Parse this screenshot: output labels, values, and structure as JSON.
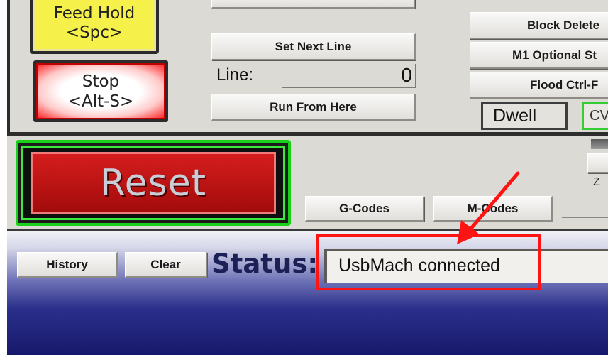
{
  "buttons": {
    "feed_hold_line1": "Feed Hold",
    "feed_hold_line2": "<Spc>",
    "stop_line1": "Stop",
    "stop_line2": "<Alt-S>",
    "reset": "Reset",
    "set_next_line": "Set Next Line",
    "run_from_here": "Run From Here",
    "block_delete": "Block Delete",
    "m1_optional_stop": "M1 Optional St",
    "flood_ctrl_f": "Flood Ctrl-F",
    "g_codes": "G-Codes",
    "m_codes": "M-Codes",
    "history": "History",
    "clear": "Clear"
  },
  "line": {
    "label": "Line:",
    "value": "0"
  },
  "indicators": {
    "dwell": "Dwell",
    "cv": "CV I"
  },
  "axis_label": "Z",
  "status": {
    "label": "Status:",
    "message": "UsbMach connected"
  },
  "annotation": {
    "color": "#ff1414"
  },
  "colors": {
    "feed_hold": "#f6f14a",
    "stop_glow": "#ff2a2a",
    "reset_red": "#c01414",
    "reset_frame": "#18d118",
    "status_band": "#16196b"
  }
}
